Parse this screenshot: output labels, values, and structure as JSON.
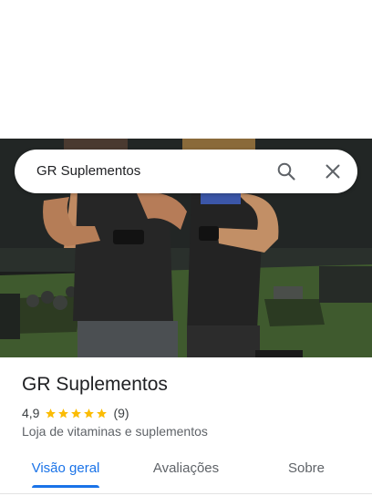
{
  "search": {
    "query": "GR Suplementos"
  },
  "place": {
    "name": "GR Suplementos",
    "rating": "4,9",
    "rating_value": 4.9,
    "stars": 5,
    "review_count": "(9)",
    "category": "Loja de vitaminas e suplementos"
  },
  "tabs": [
    {
      "label": "Visão geral",
      "active": true
    },
    {
      "label": "Avaliações",
      "active": false
    },
    {
      "label": "Sobre",
      "active": false
    }
  ],
  "colors": {
    "accent": "#1a73e8",
    "star": "#fbbc04",
    "photo_floor": "#3f5a2e"
  },
  "icons": [
    "search-icon",
    "close-icon",
    "star-icon"
  ]
}
